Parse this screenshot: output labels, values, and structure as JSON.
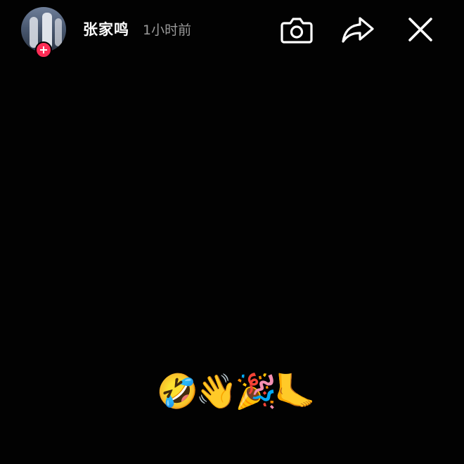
{
  "header": {
    "username": "张家鸣",
    "timestamp": "1小时前",
    "avatar_icon": "user-avatar",
    "follow_icon": "plus-icon"
  },
  "actions": {
    "camera_icon": "camera-icon",
    "share_icon": "share-icon",
    "close_icon": "close-icon"
  },
  "caption": {
    "emojis": "🤣👋🎉🦶"
  },
  "colors": {
    "background": "#020202",
    "accent": "#fe2c55",
    "username": "#ffffff",
    "timestamp": "#9a9a9a"
  }
}
